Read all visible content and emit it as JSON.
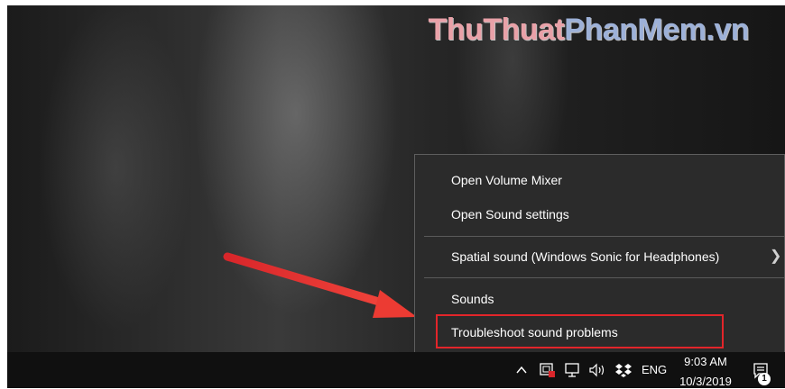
{
  "watermark": {
    "part1": "ThuThuat",
    "part2": "PhanMem.vn"
  },
  "context_menu": {
    "items": [
      {
        "label": "Open Volume Mixer"
      },
      {
        "label": "Open Sound settings"
      },
      {
        "label": "Spatial sound (Windows Sonic for Headphones)",
        "submenu_icon": "chevron-right-icon"
      },
      {
        "label": "Sounds"
      },
      {
        "label": "Troubleshoot sound problems",
        "highlighted": true
      }
    ],
    "highlight_color": "#e3252a"
  },
  "annotation_arrow": {
    "color": "#e3342f",
    "points_to": "Troubleshoot sound problems"
  },
  "taskbar": {
    "tray_icons": [
      "chevron-up-icon",
      "security-alert-icon",
      "network-icon",
      "volume-icon",
      "dropbox-icon"
    ],
    "language": "ENG",
    "time": "9:03 AM",
    "date": "10/3/2019",
    "notification_count": "1"
  }
}
